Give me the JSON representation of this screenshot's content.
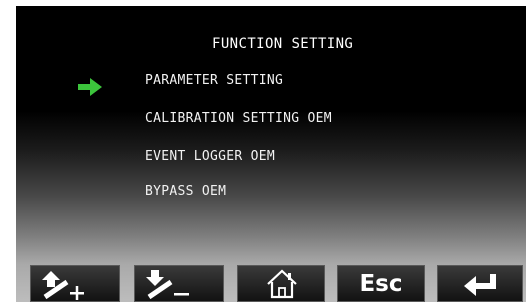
{
  "screen": {
    "title": "FUNCTION SETTING",
    "selected_index": 0,
    "menu": [
      {
        "label": "PARAMETER SETTING"
      },
      {
        "label": "CALIBRATION SETTING OEM"
      },
      {
        "label": "EVENT LOGGER OEM"
      },
      {
        "label": "BYPASS OEM"
      }
    ],
    "cursor_icon": "green-right-arrow"
  },
  "toolbar": {
    "buttons": [
      {
        "name": "up-plus",
        "icon": "up-arrow-plus-icon"
      },
      {
        "name": "down-minus",
        "icon": "down-arrow-minus-icon"
      },
      {
        "name": "home",
        "icon": "home-icon"
      },
      {
        "name": "esc",
        "label": "Esc"
      },
      {
        "name": "enter",
        "icon": "enter-return-arrow-icon"
      }
    ]
  },
  "colors": {
    "background_top": "#000000",
    "background_bottom": "#bdbdbd",
    "text": "#ffffff",
    "cursor": "#3cc43c"
  }
}
